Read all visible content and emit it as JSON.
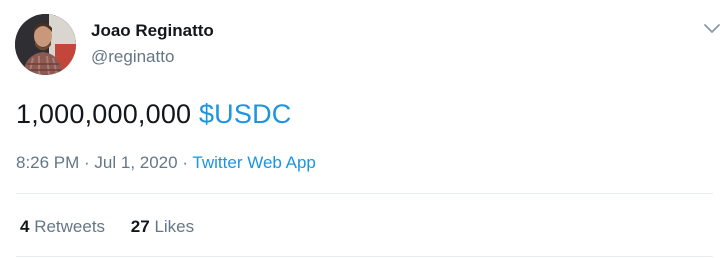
{
  "author": {
    "name": "Joao Reginatto",
    "handle": "@reginatto"
  },
  "tweet": {
    "text_plain": "1,000,000,000 ",
    "cashtag": "$USDC"
  },
  "meta": {
    "time": "8:26 PM",
    "separator1": " · ",
    "date": "Jul 1, 2020",
    "separator2": " · ",
    "source": "Twitter Web App"
  },
  "stats": {
    "retweets_count": "4",
    "retweets_label": " Retweets",
    "likes_count": "27",
    "likes_label": " Likes"
  },
  "icons": {
    "menu": "chevron-down-icon",
    "avatar": "profile-photo"
  },
  "colors": {
    "link": "#1b95e0",
    "secondary_text": "#657786",
    "primary_text": "#14171a",
    "divider": "#e6ecf0"
  }
}
